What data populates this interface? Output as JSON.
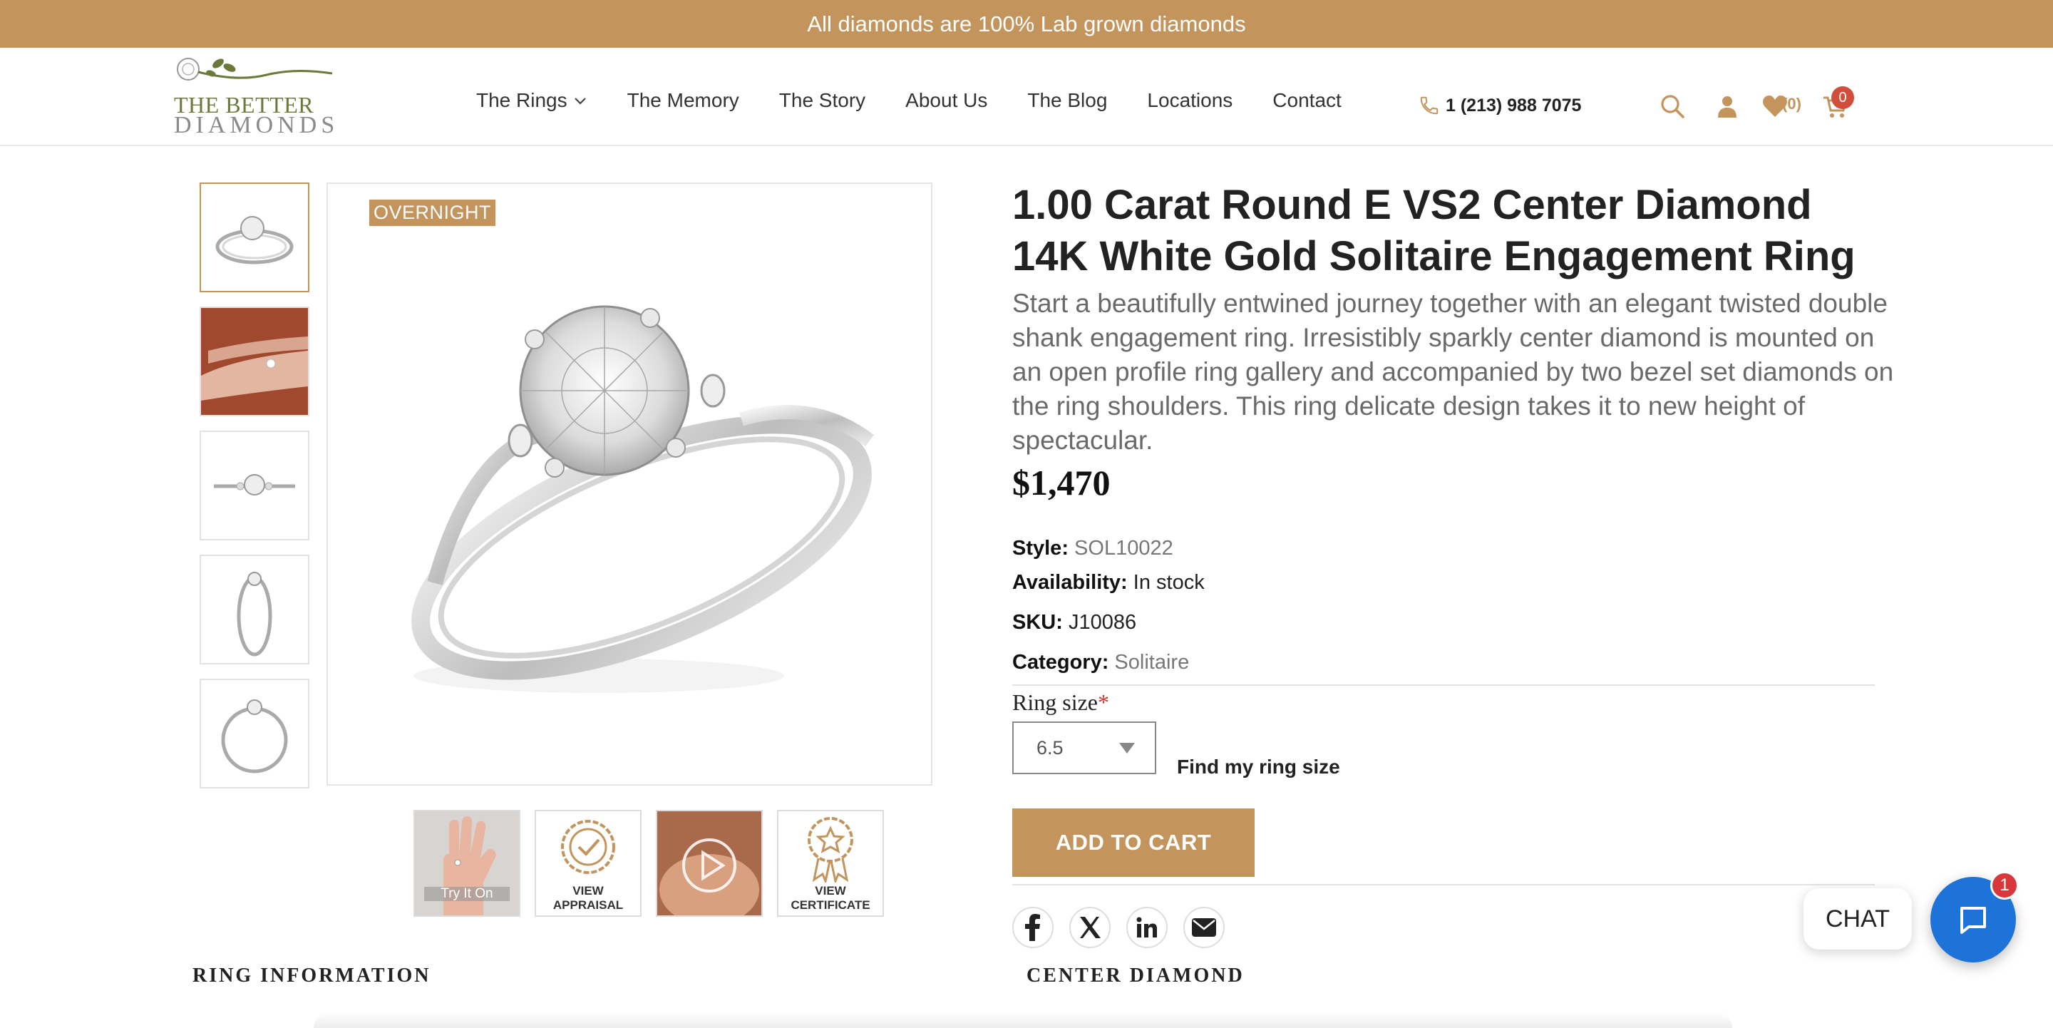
{
  "announcement": "All diamonds are 100% Lab grown diamonds",
  "logo": {
    "line1": "THE BETTER",
    "line2": "DIAMONDS"
  },
  "nav": {
    "items": [
      "The Rings",
      "The Memory",
      "The Story",
      "About Us",
      "The Blog",
      "Locations",
      "Contact"
    ]
  },
  "header": {
    "phone": "1 (213) 988 7075",
    "wishlist_count": "0",
    "cart_count": "0"
  },
  "gallery": {
    "badge": "OVERNIGHT",
    "tiles": {
      "try_on": "Try It On",
      "appraisal_1": "VIEW",
      "appraisal_2": "APPRAISAL",
      "certificate_1": "VIEW",
      "certificate_2": "CERTIFICATE"
    }
  },
  "product": {
    "title": "1.00 Carat Round E VS2 Center Diamond 14K White Gold Solitaire Engagement Ring",
    "description": "Start a beautifully entwined journey together with an elegant twisted double shank engagement ring. Irresistibly sparkly center diamond is mounted on an open profile ring gallery and accompanied by two bezel set diamonds on the ring shoulders. This ring delicate design takes it to new height of spectacular.",
    "price": "$1,470",
    "style_label": "Style:",
    "style": "SOL10022",
    "availability_label": "Availability:",
    "availability": "In stock",
    "sku_label": "SKU:",
    "sku": "J10086",
    "category_label": "Category:",
    "category": "Solitaire",
    "ring_size_label": "Ring size",
    "ring_size_required": "*",
    "ring_size_value": "6.5",
    "find_ring_size": "Find my ring size",
    "add_to_cart": "ADD TO CART"
  },
  "sections": {
    "ring_information": "RING INFORMATION",
    "center_diamond": "CENTER DIAMOND"
  },
  "chat": {
    "label": "CHAT",
    "badge": "1"
  },
  "colors": {
    "accent": "#c4945d",
    "chat_blue": "#1e73d8",
    "badge_red": "#d24d3a"
  }
}
